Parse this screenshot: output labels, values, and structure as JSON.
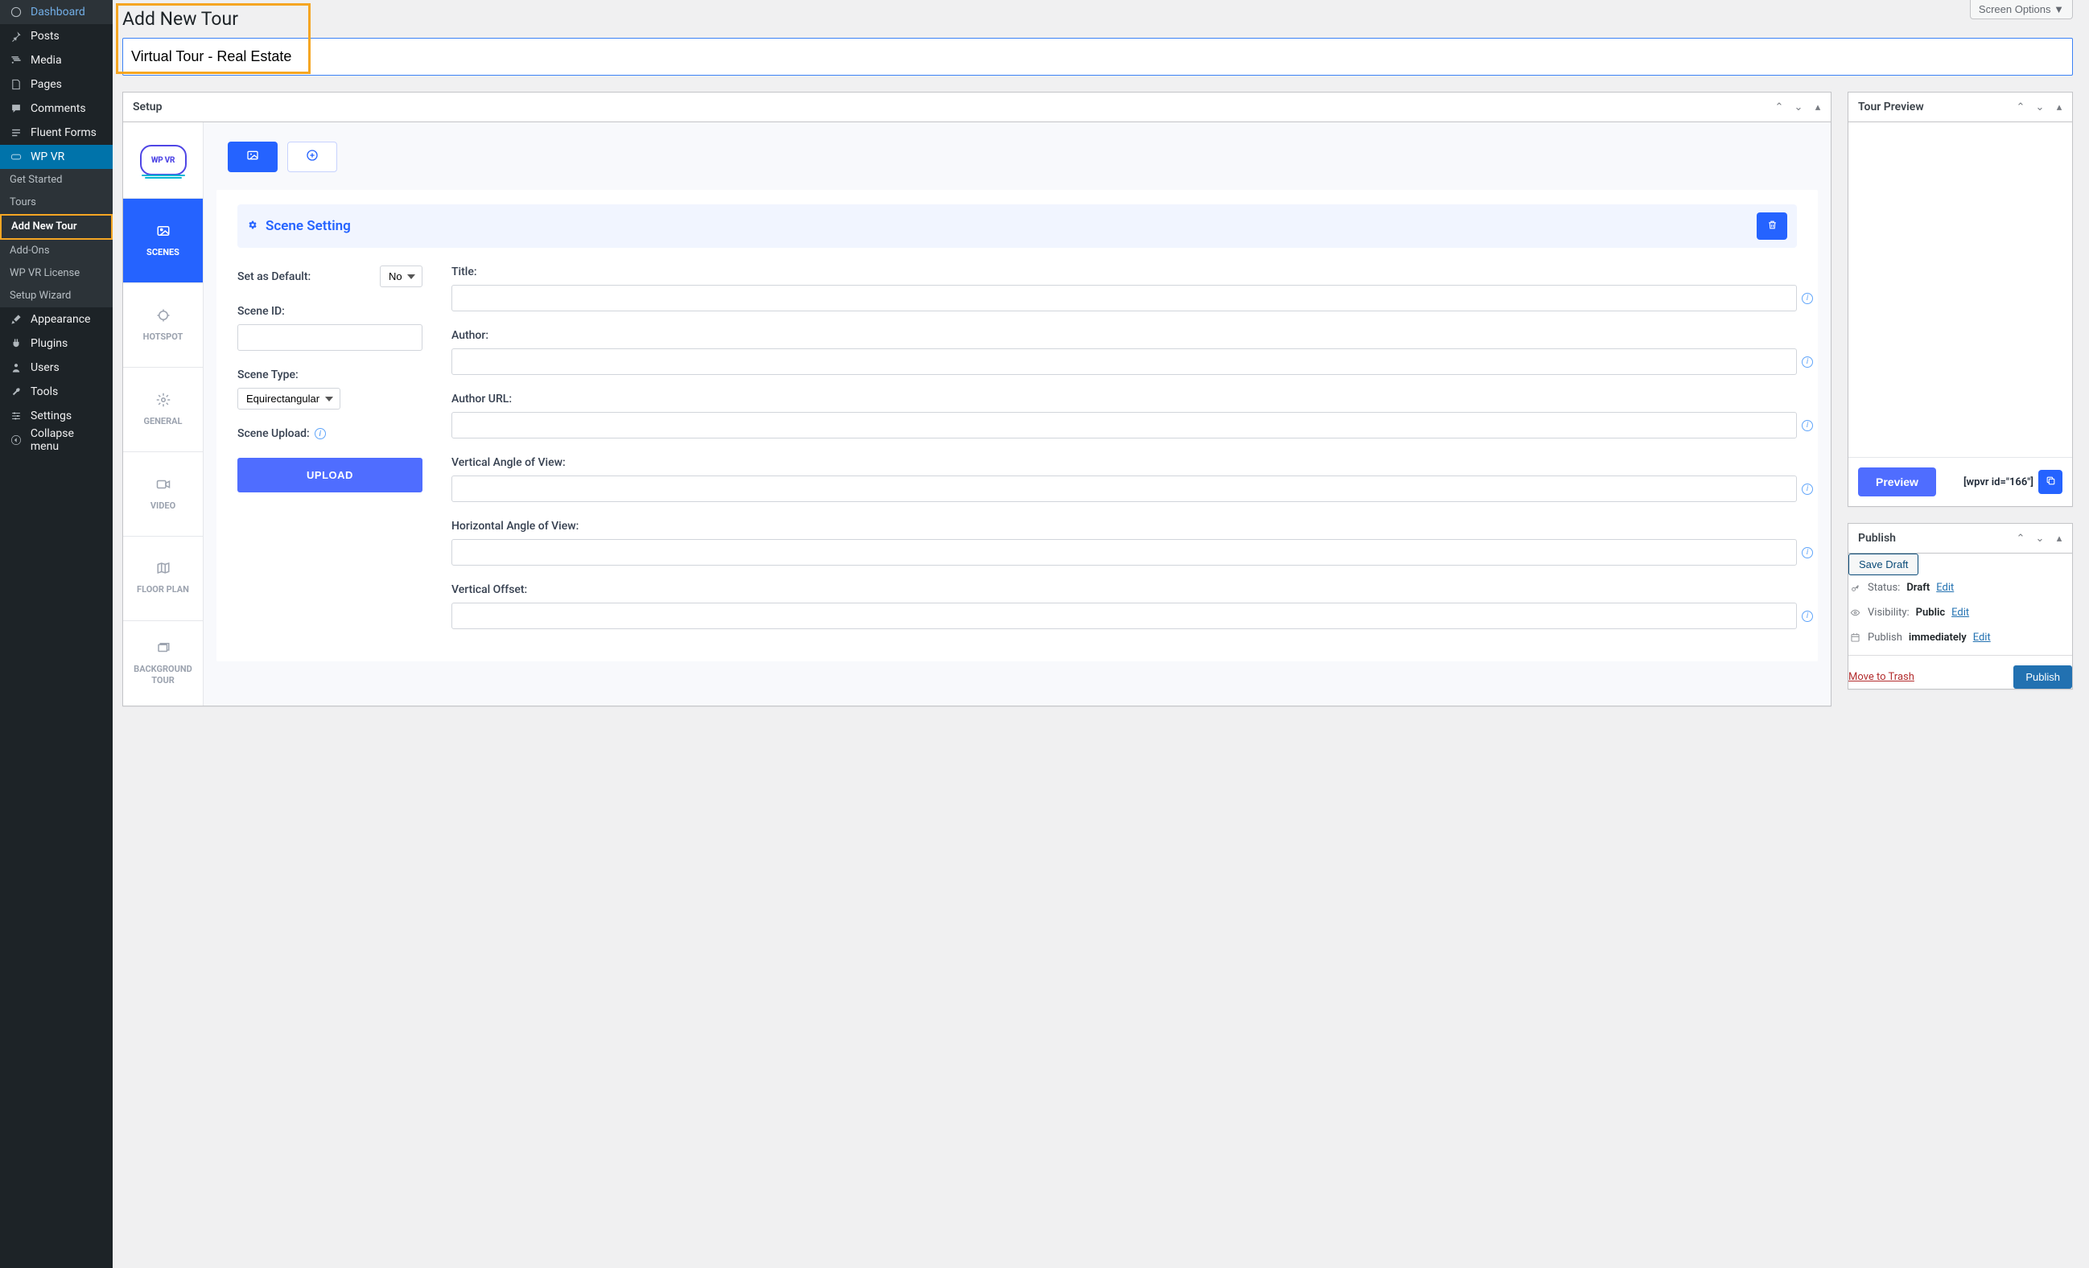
{
  "screenOptions": "Screen Options",
  "pageTitle": "Add New Tour",
  "titleInput": "Virtual Tour - Real Estate",
  "sidebar": {
    "dashboard": "Dashboard",
    "posts": "Posts",
    "media": "Media",
    "pages": "Pages",
    "comments": "Comments",
    "fluentForms": "Fluent Forms",
    "wpvr": "WP VR",
    "appearance": "Appearance",
    "plugins": "Plugins",
    "users": "Users",
    "tools": "Tools",
    "settings": "Settings",
    "collapse": "Collapse menu"
  },
  "wpvrSub": {
    "getStarted": "Get Started",
    "tours": "Tours",
    "addNew": "Add New Tour",
    "addons": "Add-Ons",
    "license": "WP VR License",
    "wizard": "Setup Wizard"
  },
  "setup": {
    "panelTitle": "Setup",
    "logoText": "WP VR",
    "tabs": {
      "scenes": "SCENES",
      "hotspot": "HOTSPOT",
      "general": "GENERAL",
      "video": "VIDEO",
      "floorplan": "FLOOR PLAN",
      "bgtour": "BACKGROUND TOUR"
    },
    "sceneSetting": "Scene Setting",
    "labels": {
      "setDefault": "Set as Default:",
      "setDefaultVal": "No",
      "sceneId": "Scene ID:",
      "sceneType": "Scene Type:",
      "sceneTypeVal": "Equirectangular",
      "sceneUpload": "Scene Upload:",
      "uploadBtn": "UPLOAD",
      "title": "Title:",
      "author": "Author:",
      "authorUrl": "Author URL:",
      "vAngle": "Vertical Angle of View:",
      "hAngle": "Horizontal Angle of View:",
      "vOffset": "Vertical Offset:"
    }
  },
  "preview": {
    "panelTitle": "Tour Preview",
    "previewBtn": "Preview",
    "shortcode": "[wpvr id=\"166\"]"
  },
  "publish": {
    "panelTitle": "Publish",
    "saveDraft": "Save Draft",
    "statusLabel": "Status:",
    "statusVal": "Draft",
    "visibilityLabel": "Visibility:",
    "visibilityVal": "Public",
    "publishLabel": "Publish",
    "publishVal": "immediately",
    "edit": "Edit",
    "trash": "Move to Trash",
    "publishBtn": "Publish"
  }
}
